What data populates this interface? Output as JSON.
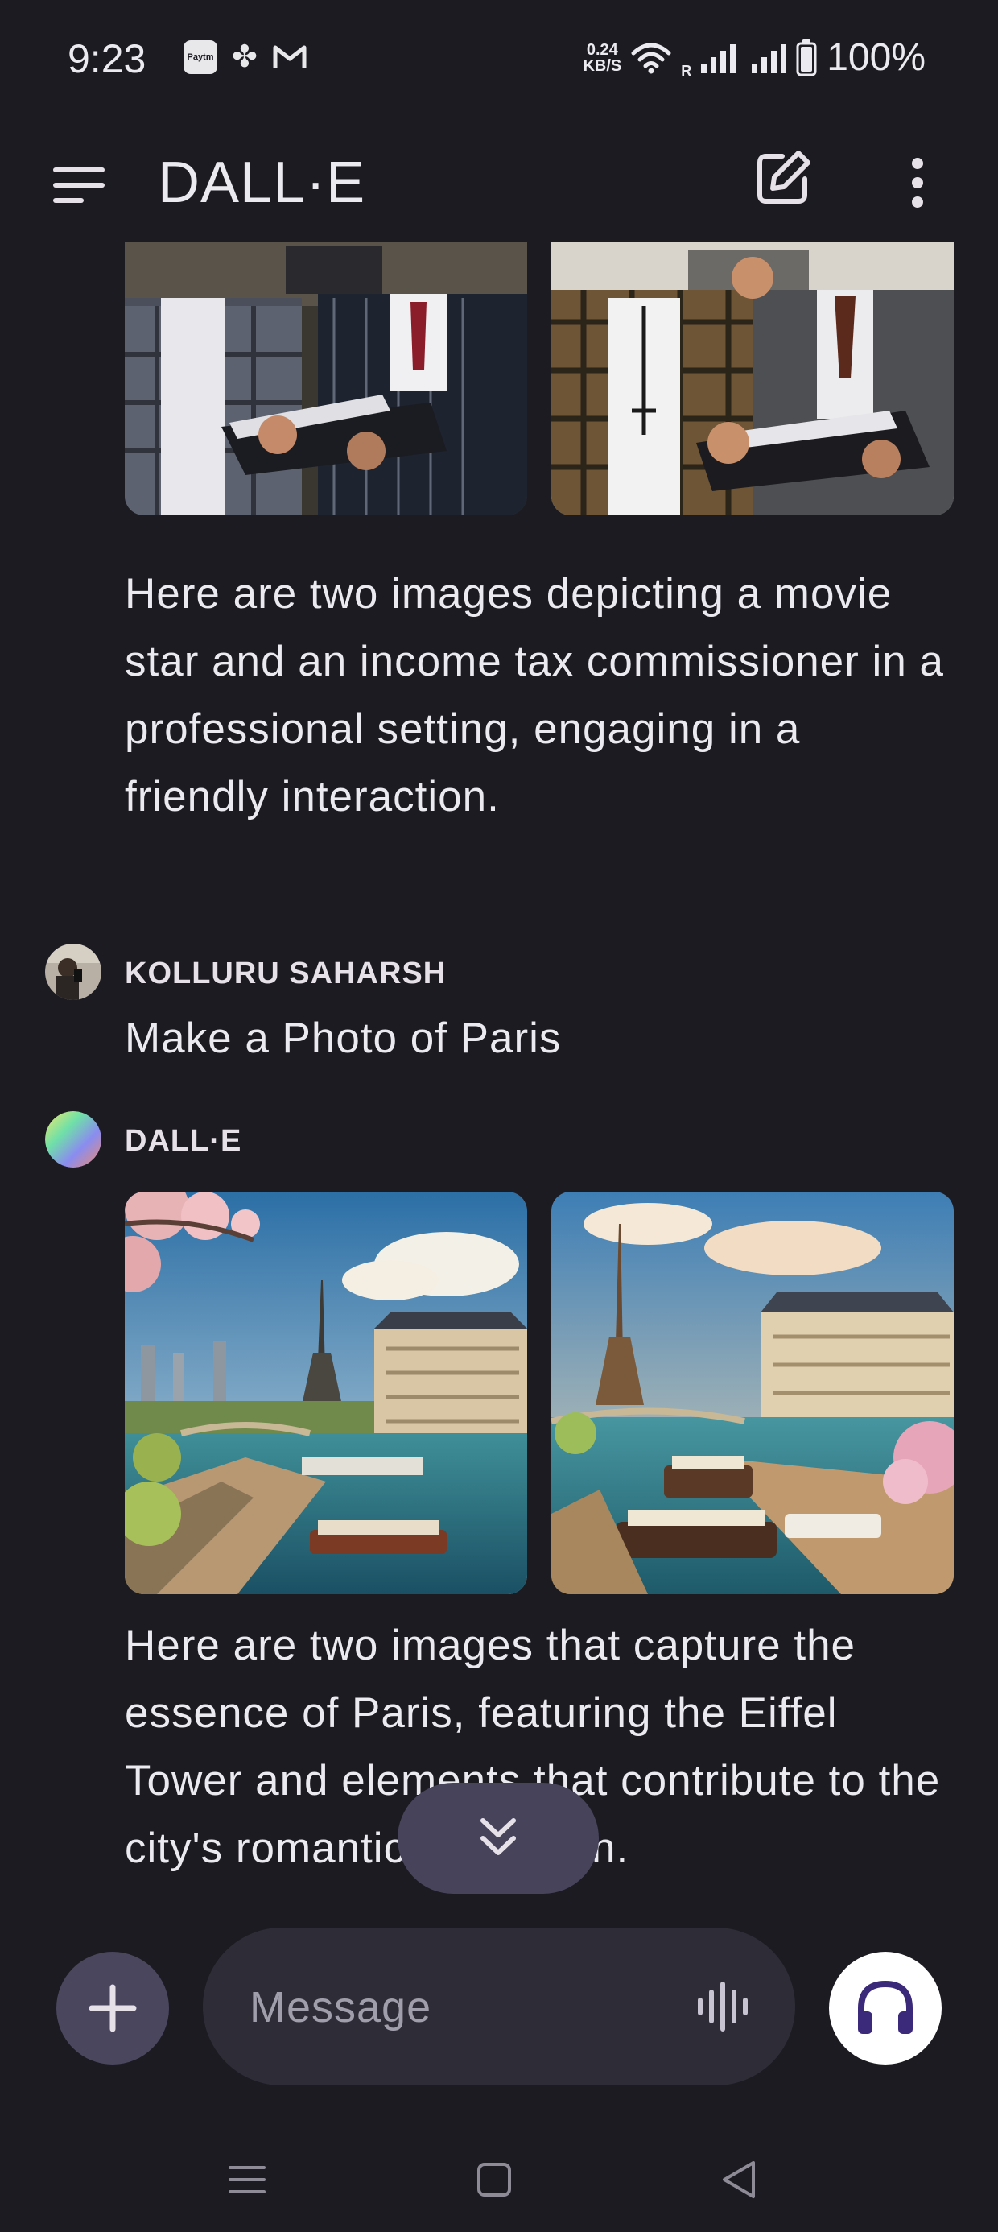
{
  "status_bar": {
    "time": "9:23",
    "app_icons": [
      "paytm-icon",
      "pinwheel-icon",
      "gmail-icon"
    ],
    "paytm_text": "Paytm",
    "net_speed_value": "0.24",
    "net_speed_unit": "KB/S",
    "roaming_label": "R",
    "battery_percent": "100%"
  },
  "app_bar": {
    "title": "DALL·E"
  },
  "conversation": {
    "first_images_alt": [
      "Movie star and income tax commissioner image 1",
      "Movie star and income tax commissioner image 2"
    ],
    "dalle_message_1": "Here are two images depicting a movie star and an income tax commissioner in a professional setting, engaging in a friendly interaction.",
    "user_name": "KOLLURU SAHARSH",
    "user_message": "Make a Photo of Paris",
    "bot_name": "DALL·E",
    "dalle_message_2": "Here are two images that capture the essence of Paris, featuring the Eiffel Tower and elements that contribute to the city's romantic reputation."
  },
  "composer": {
    "placeholder": "Message"
  },
  "colors": {
    "background": "#1c1b21",
    "accent_button": "#4a465e",
    "headphones_icon": "#3b2a7a"
  }
}
